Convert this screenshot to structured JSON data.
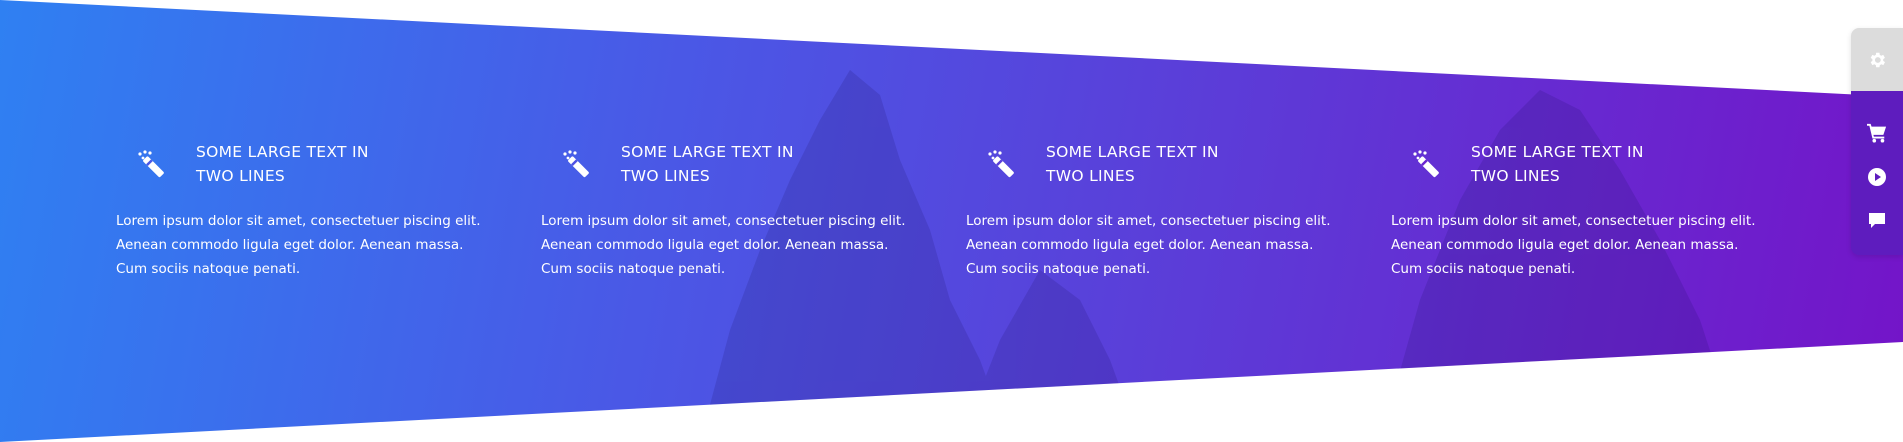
{
  "features": [
    {
      "icon": "magic-wand-icon",
      "title_line1": "SOME LARGE TEXT IN",
      "title_line2": "TWO LINES",
      "text": "Lorem ipsum dolor sit amet, consectetuer piscing elit. Aenean commodo ligula eget dolor. Aenean massa. Cum sociis natoque penati."
    },
    {
      "icon": "magic-wand-icon",
      "title_line1": "SOME LARGE TEXT IN",
      "title_line2": "TWO LINES",
      "text": "Lorem ipsum dolor sit amet, consectetuer piscing elit. Aenean commodo ligula eget dolor. Aenean massa. Cum sociis natoque penati."
    },
    {
      "icon": "magic-wand-icon",
      "title_line1": "SOME LARGE TEXT IN",
      "title_line2": "TWO LINES",
      "text": "Lorem ipsum dolor sit amet, consectetuer piscing elit. Aenean commodo ligula eget dolor. Aenean massa. Cum sociis natoque penati."
    },
    {
      "icon": "magic-wand-icon",
      "title_line1": "SOME LARGE TEXT IN",
      "title_line2": "TWO LINES",
      "text": "Lorem ipsum dolor sit amet, consectetuer piscing elit. Aenean commodo ligula eget dolor. Aenean massa. Cum sociis natoque penati."
    }
  ],
  "side_panel": {
    "settings_icon": "gear-icon",
    "tools": [
      "cart-icon",
      "play-icon",
      "chat-icon"
    ]
  },
  "colors": {
    "gradient_start": "#2f80f2",
    "gradient_mid": "#5a3fd9",
    "gradient_end": "#7414c8",
    "side_panel_top": "#dcdcdc",
    "side_panel_bottom": "#5e1cbe",
    "text": "#ffffff"
  }
}
